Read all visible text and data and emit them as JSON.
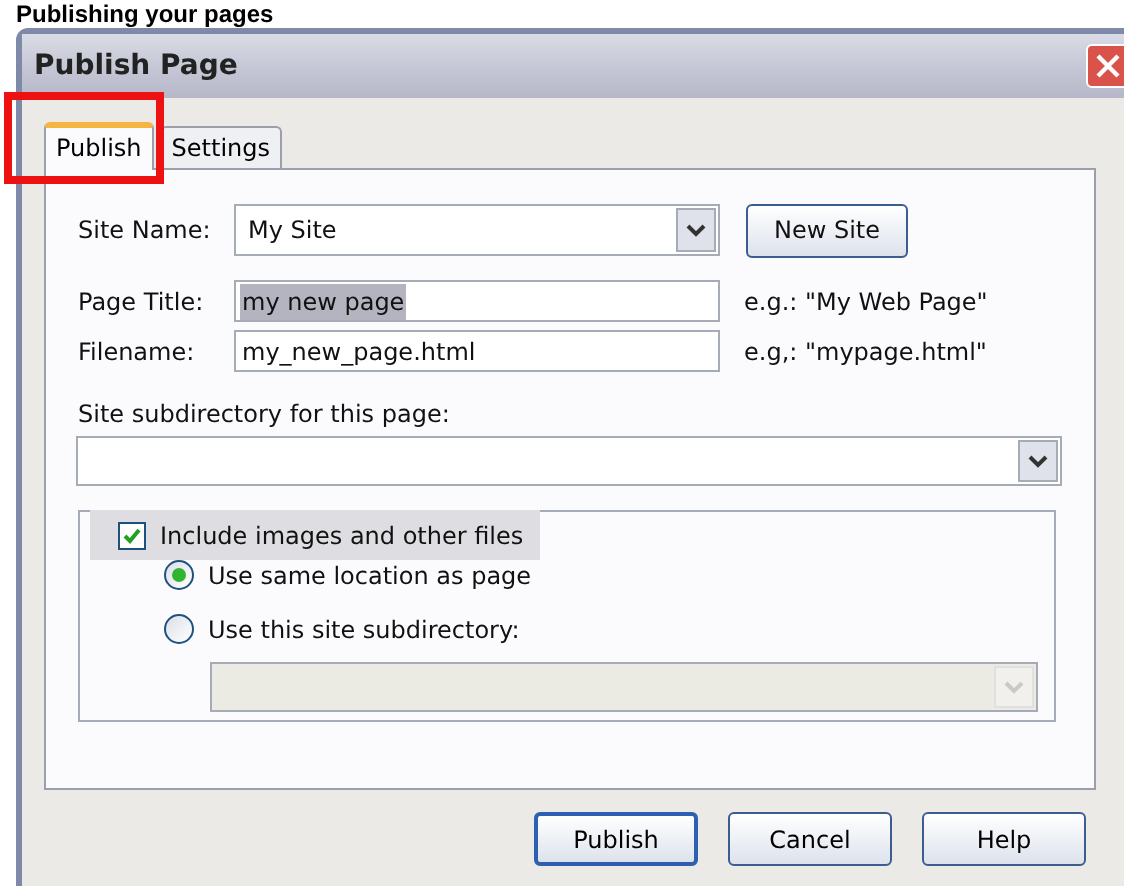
{
  "page_heading": "Publishing your pages",
  "window": {
    "title": "Publish Page"
  },
  "tabs": [
    {
      "label": "Publish",
      "selected": true
    },
    {
      "label": "Settings",
      "selected": false
    }
  ],
  "site_name": {
    "label": "Site Name:",
    "value": "My Site",
    "button": "New Site"
  },
  "page_title": {
    "label": "Page Title:",
    "value": "my new page",
    "value_selected": true,
    "hint": "e.g.: \"My Web Page\""
  },
  "filename": {
    "label": "Filename:",
    "value": "my_new_page.html",
    "value_selected": false,
    "hint": "e.g,: \"mypage.html\""
  },
  "subdirectory": {
    "label": "Site subdirectory for this page:"
  },
  "include_files": {
    "label": "Include images and other files",
    "checked": true,
    "options": [
      {
        "label": "Use same location as page",
        "selected": true
      },
      {
        "label": "Use this site subdirectory:",
        "selected": false
      }
    ],
    "subdirectory_disabled": true
  },
  "buttons": [
    {
      "label": "Publish",
      "default": true
    },
    {
      "label": "Cancel",
      "default": false
    },
    {
      "label": "Help",
      "default": false
    }
  ]
}
